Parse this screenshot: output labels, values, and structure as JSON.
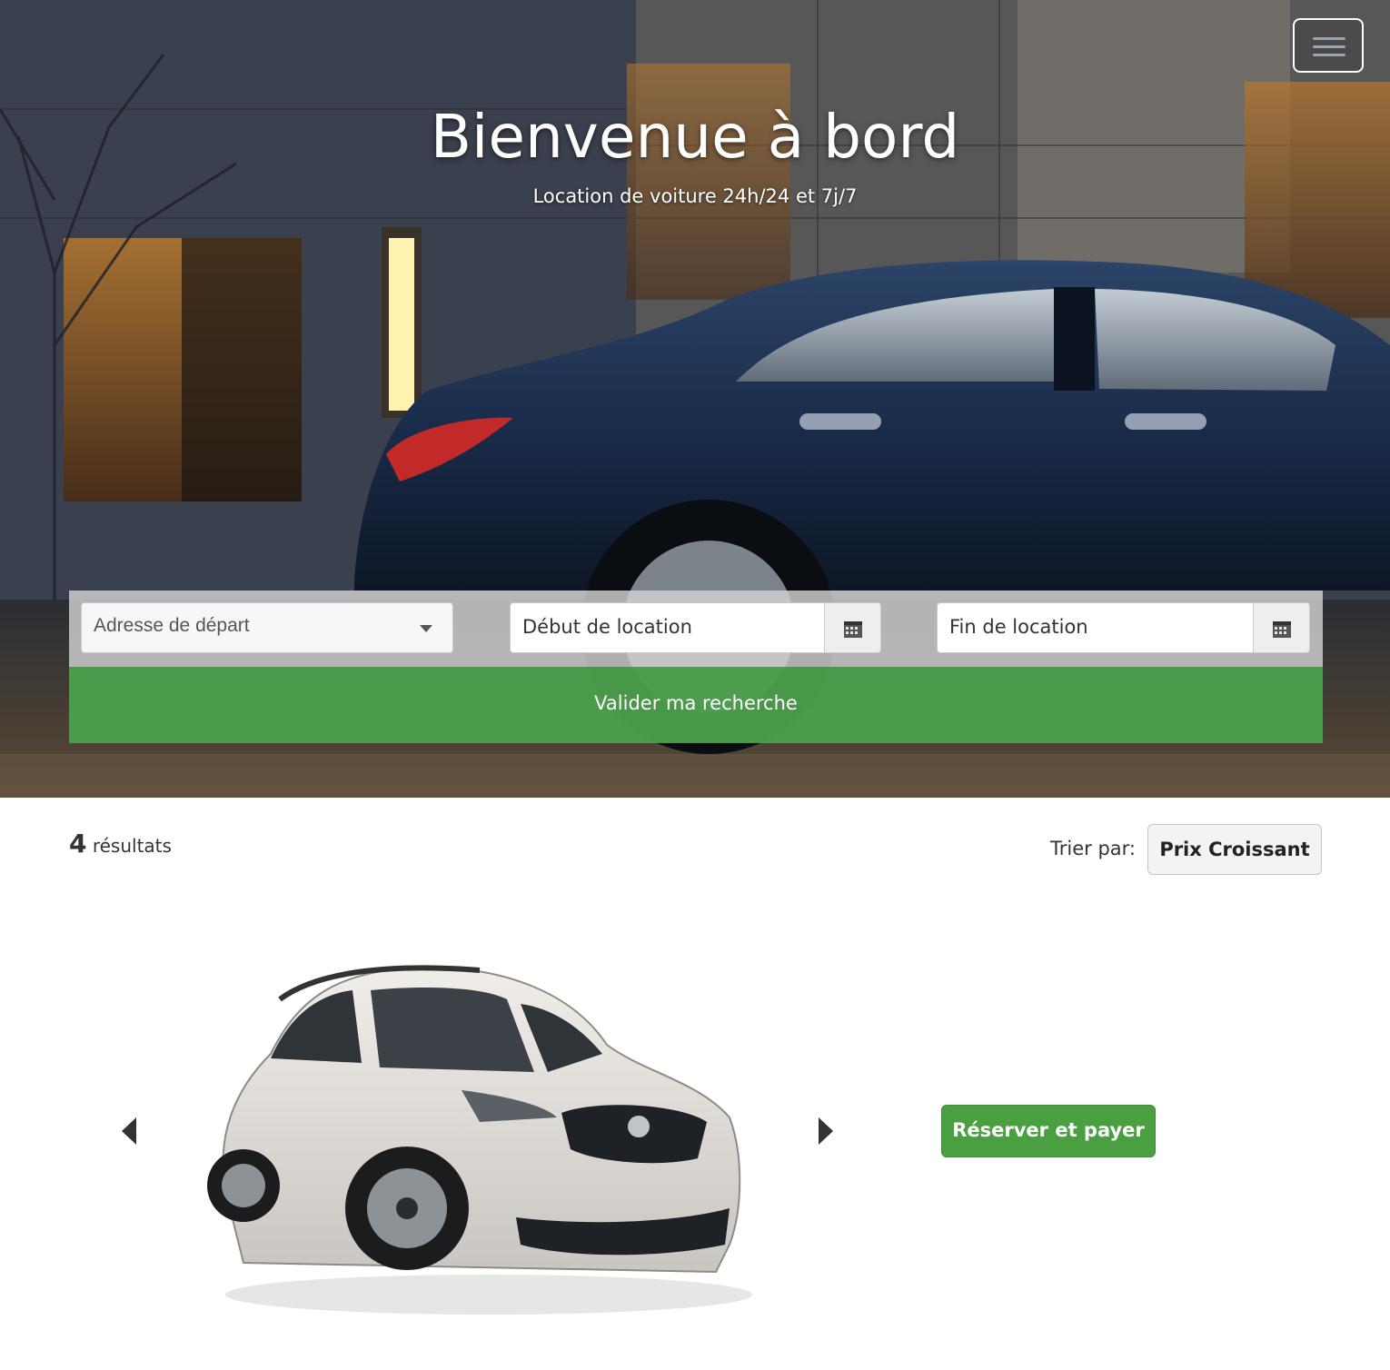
{
  "hero": {
    "title": "Bienvenue à bord",
    "subtitle": "Location de voiture 24h/24 et 7j/7",
    "menu_icon": "hamburger-icon"
  },
  "search": {
    "address_placeholder": "Adresse de départ",
    "start_placeholder": "Début de location",
    "end_placeholder": "Fin de location",
    "calendar_icon": "calendar-icon",
    "submit_label": "Valider ma recherche"
  },
  "results": {
    "count": "4",
    "count_label": "résultats",
    "sort_label": "Trier par:",
    "sort_value": "Prix Croissant"
  },
  "listing": {
    "book_label": "Réserver et payer",
    "prev_icon": "chevron-left-icon",
    "next_icon": "chevron-right-icon"
  },
  "colors": {
    "accent_green": "#4aa041",
    "panel_green": "#4c9e4c",
    "car_blue": "#1e3150"
  }
}
